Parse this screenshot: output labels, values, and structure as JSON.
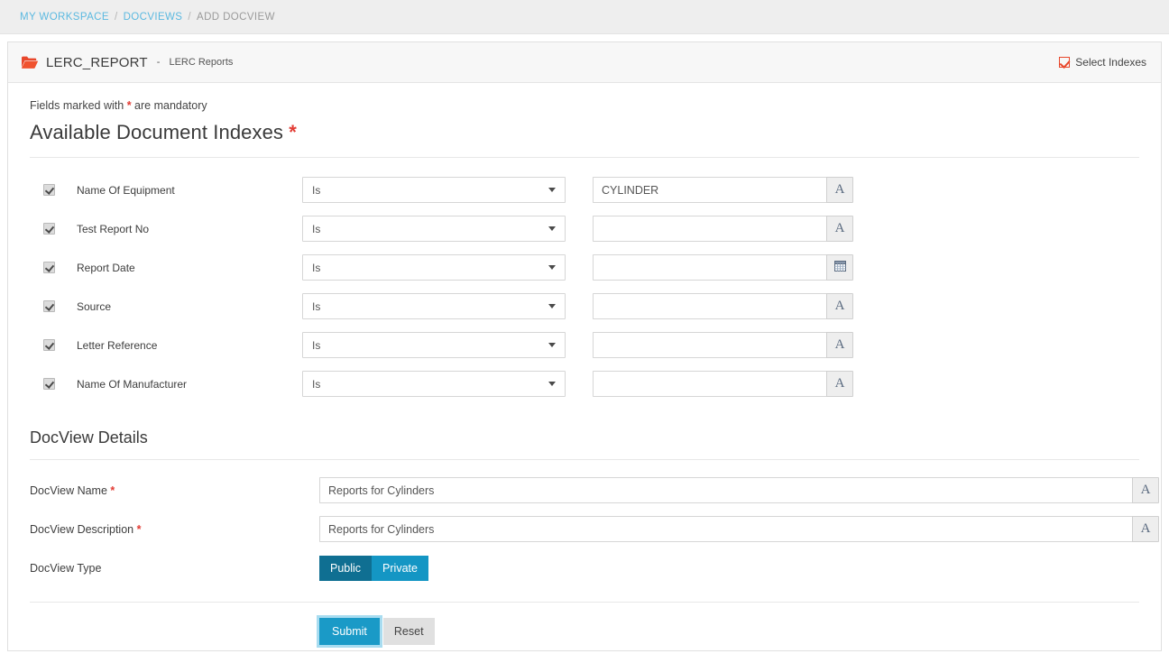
{
  "breadcrumb": {
    "items": [
      {
        "label": "MY WORKSPACE",
        "active": false
      },
      {
        "label": "DOCVIEWS",
        "active": false
      },
      {
        "label": "ADD DOCVIEW",
        "active": true
      }
    ],
    "separator": "/"
  },
  "header": {
    "folder_icon": "folder-open-icon",
    "repository_code": "LERC_REPORT",
    "dash": "-",
    "repository_name": "LERC Reports",
    "select_indexes_label": "Select Indexes",
    "select_indexes_checked": true
  },
  "form": {
    "mandatory_note_prefix": "Fields marked with",
    "mandatory_star": "*",
    "mandatory_note_suffix": "are mandatory",
    "indexes_section_title": "Available Document Indexes",
    "indexes_section_star": "*",
    "condition_options": [
      "Is"
    ],
    "indexes": [
      {
        "checked": true,
        "label": "Name Of Equipment",
        "condition": "Is",
        "value": "CYLINDER",
        "placeholder": "",
        "addon": "A"
      },
      {
        "checked": true,
        "label": "Test Report No",
        "condition": "Is",
        "value": "",
        "placeholder": "",
        "addon": "A"
      },
      {
        "checked": true,
        "label": "Report Date",
        "condition": "Is",
        "value": "",
        "placeholder": "",
        "addon": "calendar-icon"
      },
      {
        "checked": true,
        "label": "Source",
        "condition": "Is",
        "value": "",
        "placeholder": "",
        "addon": "A"
      },
      {
        "checked": true,
        "label": "Letter Reference",
        "condition": "Is",
        "value": "",
        "placeholder": "",
        "addon": "A"
      },
      {
        "checked": true,
        "label": "Name Of Manufacturer",
        "condition": "Is",
        "value": "",
        "placeholder": "",
        "addon": "A"
      }
    ]
  },
  "details": {
    "title": "DocView Details",
    "name_label": "DocView Name",
    "name_star": "*",
    "name_value": "Reports for Cylinders",
    "name_addon": "A",
    "description_label": "DocView Description",
    "description_star": "*",
    "description_value": "Reports for Cylinders",
    "description_addon": "A",
    "type_label": "DocView Type",
    "type_options": [
      {
        "label": "Public",
        "selected": true
      },
      {
        "label": "Private",
        "selected": false
      }
    ]
  },
  "actions": {
    "submit_label": "Submit",
    "reset_label": "Reset"
  },
  "colors": {
    "link_blue": "#5bb9e0",
    "accent_orange": "#e8472b",
    "required_red": "#e23b33",
    "toggle_active": "#0f6f92",
    "toggle_inactive": "#1496c4",
    "submit_blue": "#1a9ac7",
    "submit_focus_ring": "#a8dcf0",
    "reset_gray": "#e0e0e0"
  }
}
